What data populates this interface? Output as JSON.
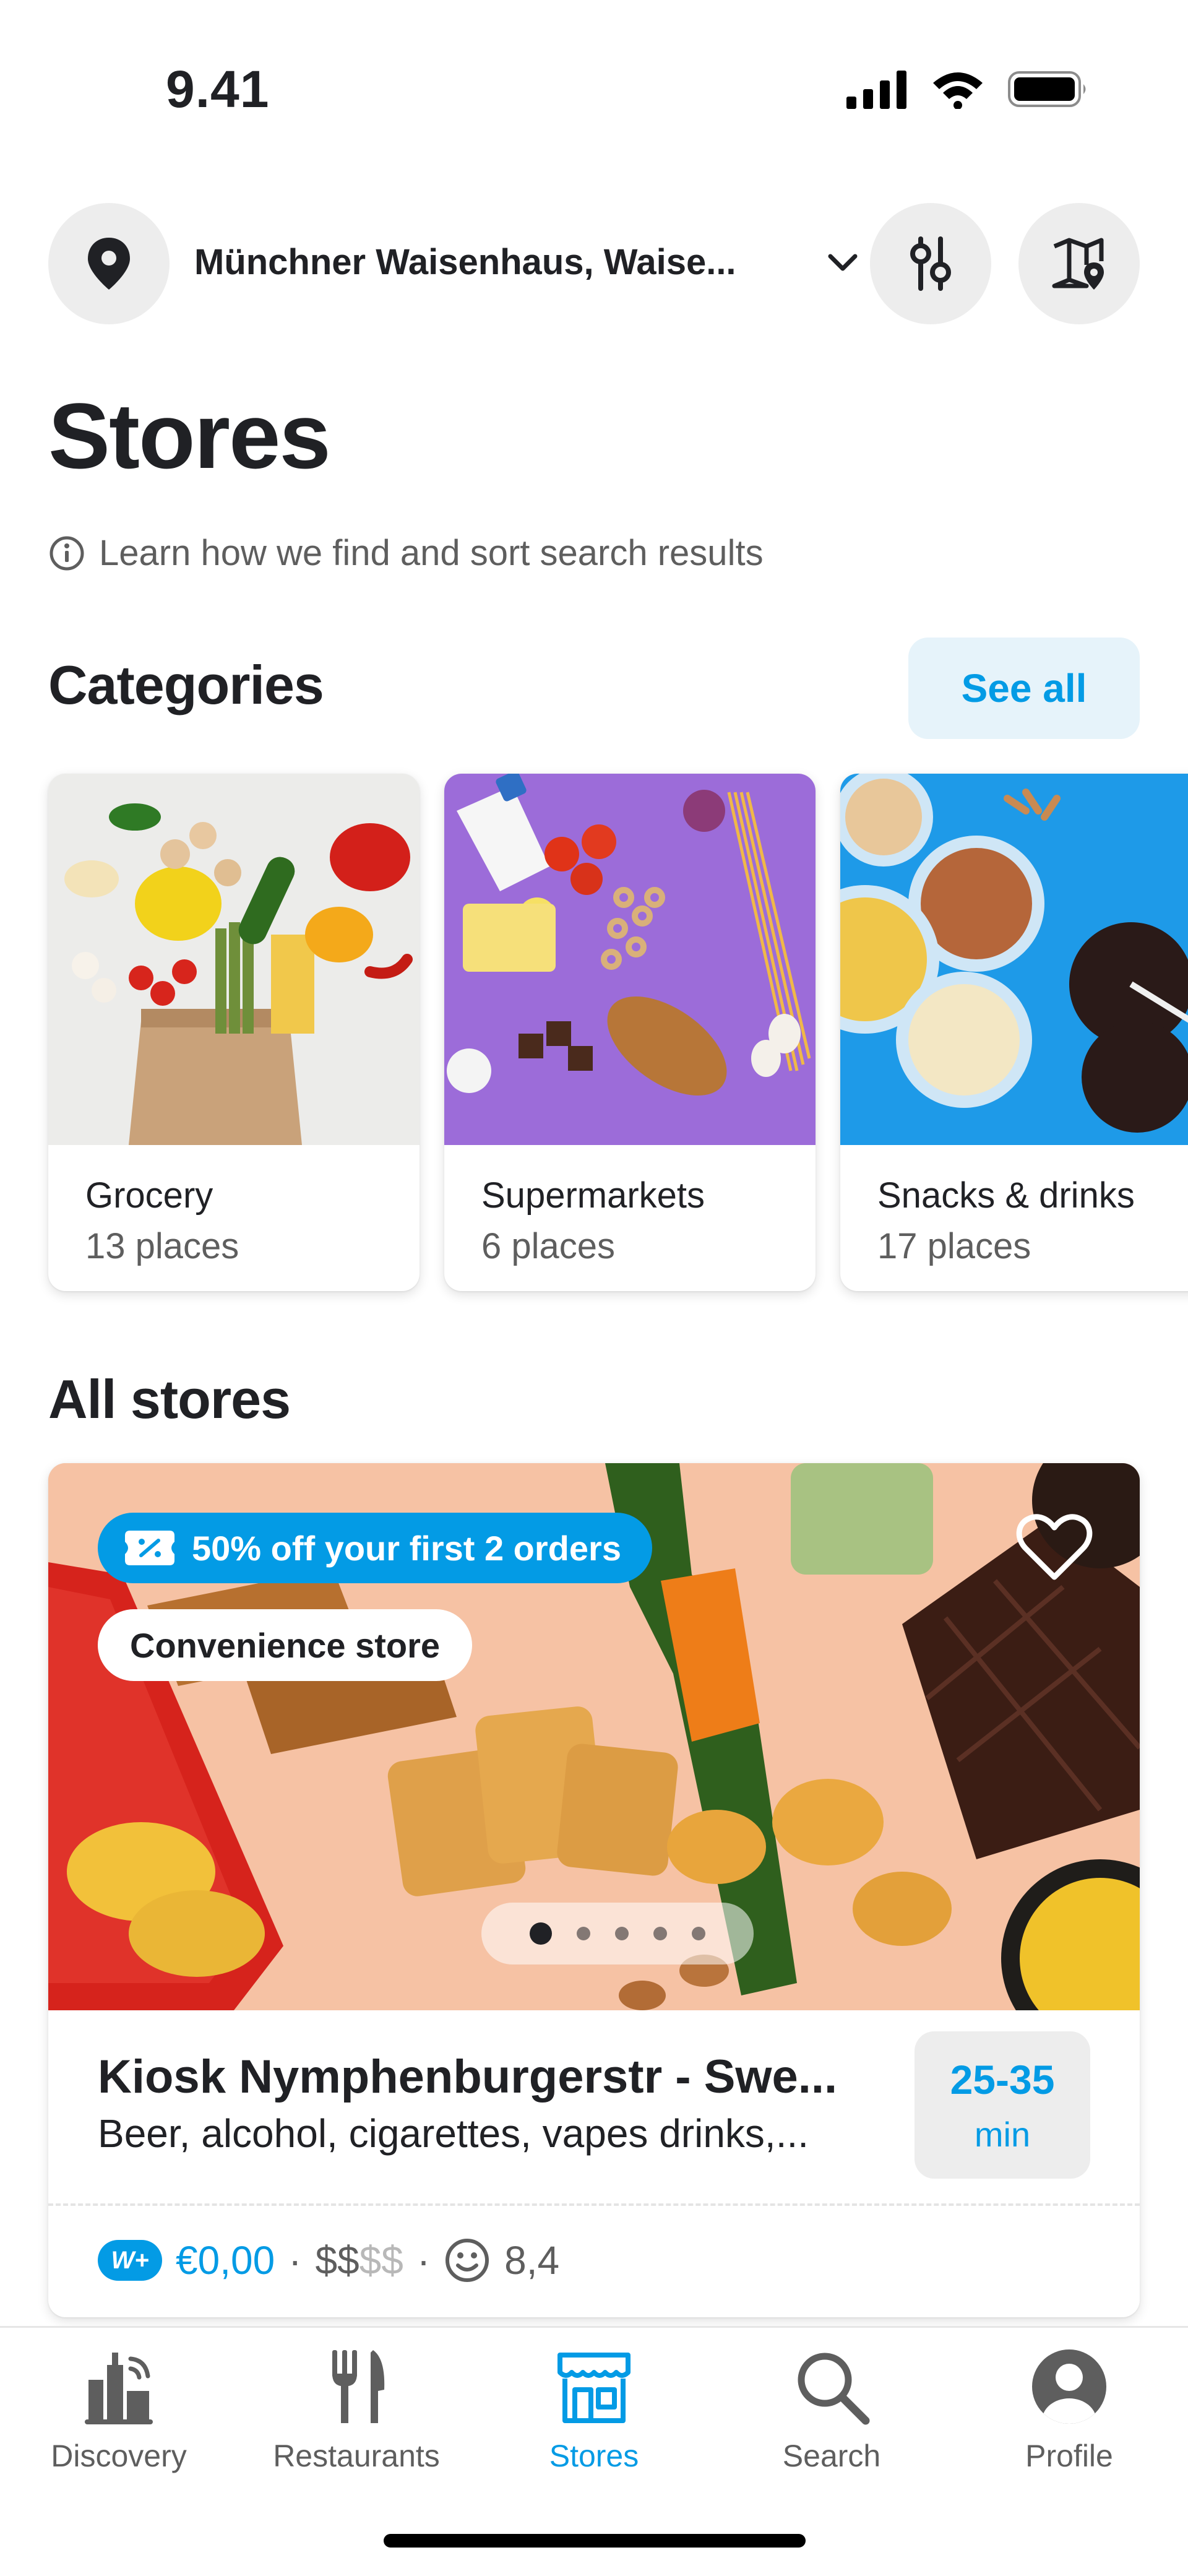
{
  "status_bar": {
    "time": "9.41"
  },
  "header": {
    "location": "Münchner Waisenhaus, Waise...",
    "title": "Stores",
    "info_text": "Learn how we find and sort search results"
  },
  "categories": {
    "title": "Categories",
    "see_all": "See all",
    "items": [
      {
        "name": "Grocery",
        "count": "13 places"
      },
      {
        "name": "Supermarkets",
        "count": "6 places"
      },
      {
        "name": "Snacks & drinks",
        "count": "17 places"
      }
    ]
  },
  "all_stores": {
    "title": "All stores",
    "store": {
      "promo": "50% off your first 2 orders",
      "type": "Convenience store",
      "name": "Kiosk Nymphenburgerstr - Swe...",
      "tags": "Beer, alcohol, cigarettes, vapes drinks,...",
      "eta_range": "25-35",
      "eta_unit": "min",
      "wplus": "W+",
      "delivery_fee": "€0,00",
      "sep1": "·",
      "price_active": "$$",
      "price_inactive": "$$",
      "sep2": "·",
      "rating": "8,4"
    }
  },
  "nav": {
    "items": [
      {
        "label": "Discovery"
      },
      {
        "label": "Restaurants"
      },
      {
        "label": "Stores"
      },
      {
        "label": "Search"
      },
      {
        "label": "Profile"
      }
    ]
  },
  "colors": {
    "accent": "#039be5",
    "text": "#202125",
    "muted": "#5e5e5e"
  }
}
